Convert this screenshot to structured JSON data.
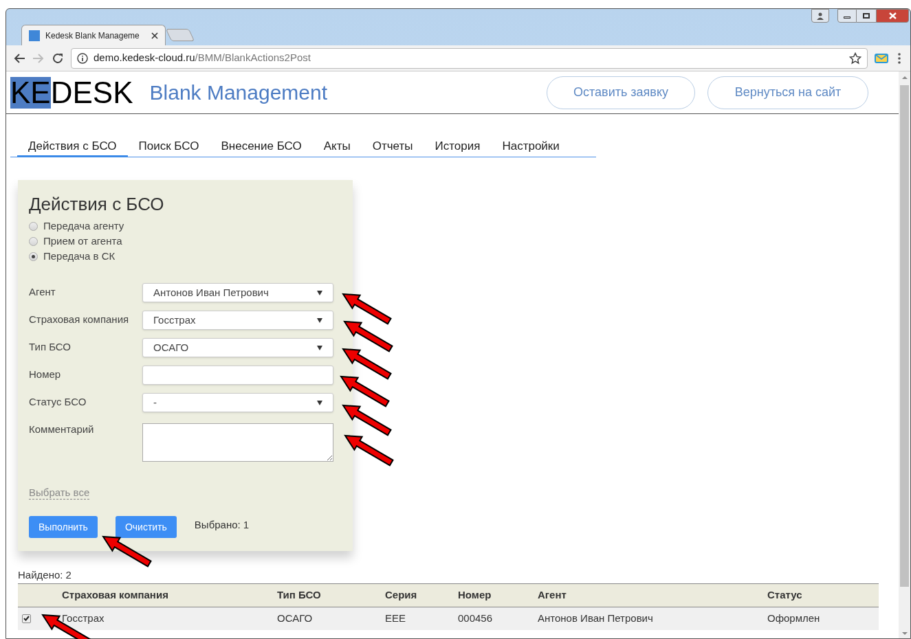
{
  "browser": {
    "tab": {
      "title": "Kedesk Blank Manageme",
      "selected": true
    },
    "address": {
      "host": "demo.kedesk-cloud.ru",
      "path": "/BMM/BlankActions2Post"
    }
  },
  "header": {
    "logo": [
      {
        "text": "KE",
        "highlighted": true
      },
      {
        "text": "DESK",
        "highlighted": false
      }
    ],
    "app_title": "Blank Management",
    "buttons": [
      "Оставить заявку",
      "Вернуться на сайт"
    ]
  },
  "nav": [
    {
      "label": "Действия с БСО",
      "selected": true
    },
    {
      "label": "Поиск БСО",
      "selected": false
    },
    {
      "label": "Внесение БСО",
      "selected": false
    },
    {
      "label": "Акты",
      "selected": false
    },
    {
      "label": "Отчеты",
      "selected": false
    },
    {
      "label": "История",
      "selected": false
    },
    {
      "label": "Настройки",
      "selected": false
    }
  ],
  "panel": {
    "title": "Действия с БСО",
    "actions": [
      {
        "label": "Передача агенту",
        "selected": false
      },
      {
        "label": "Прием от агента",
        "selected": false
      },
      {
        "label": "Передача в СК",
        "selected": true
      }
    ],
    "fields": [
      {
        "label": "Агент",
        "kind": "select",
        "value": "Антонов Иван Петрович"
      },
      {
        "label": "Страховая компания",
        "kind": "select",
        "value": "Госстрах"
      },
      {
        "label": "Тип БСО",
        "kind": "select",
        "value": "ОСАГО"
      },
      {
        "label": "Номер",
        "kind": "text"
      },
      {
        "label": "Статус БСО",
        "kind": "select",
        "value": "-"
      },
      {
        "label": "Комментарий",
        "kind": "textarea"
      }
    ],
    "select_all_link": "Выбрать все",
    "buttons": [
      "Выполнить",
      "Очистить"
    ],
    "selected_count": "Выбрано: 1"
  },
  "results": {
    "found": "Найдено: 2",
    "columns": [
      "Страховая компания",
      "Тип БСО",
      "Серия",
      "Номер",
      "Агент",
      "Статус"
    ],
    "rows": [
      {
        "checked": true,
        "cells": [
          "Госстрах",
          "ОСАГО",
          "EEE",
          "000456",
          "Антонов Иван Петрович",
          "Оформлен"
        ]
      }
    ]
  }
}
